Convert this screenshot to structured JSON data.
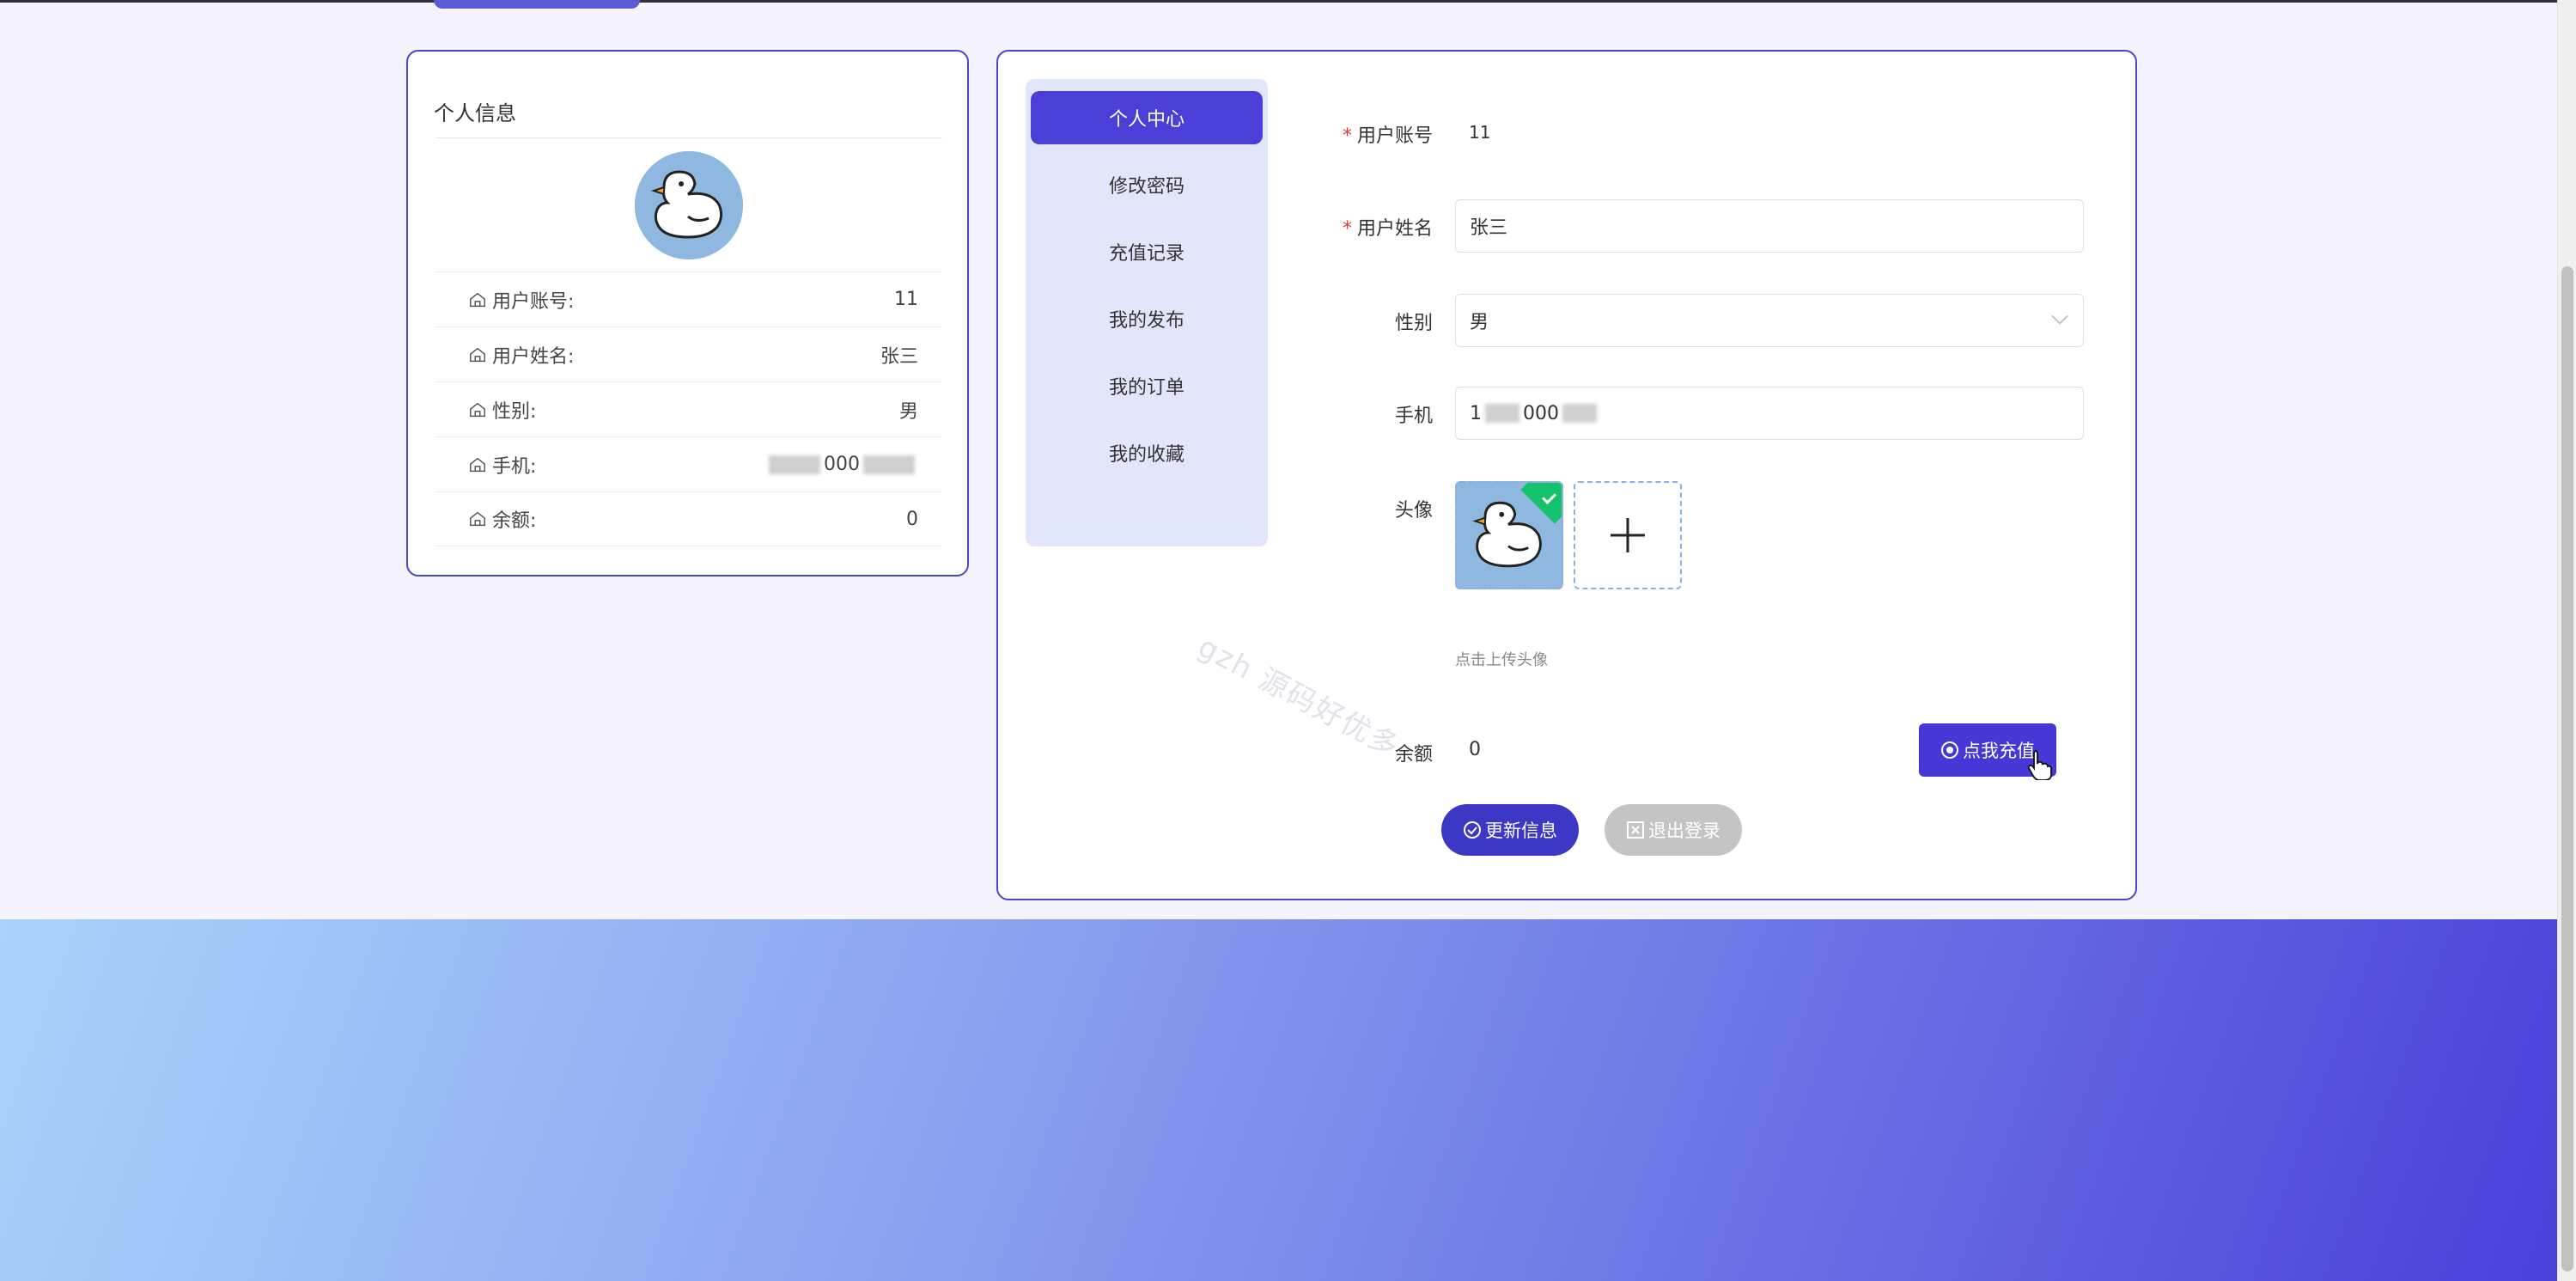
{
  "left_card": {
    "title": "个人信息",
    "rows": [
      {
        "label": "用户账号:",
        "value": "11"
      },
      {
        "label": "用户姓名:",
        "value": "张三"
      },
      {
        "label": "性别:",
        "value": "男"
      },
      {
        "label": "手机:",
        "value_suffix": "000"
      },
      {
        "label": "余额:",
        "value": "0"
      }
    ]
  },
  "menu": {
    "items": [
      {
        "label": "个人中心",
        "active": true
      },
      {
        "label": "修改密码"
      },
      {
        "label": "充值记录"
      },
      {
        "label": "我的发布"
      },
      {
        "label": "我的订单"
      },
      {
        "label": "我的收藏"
      }
    ]
  },
  "form": {
    "required_mark": "*",
    "account_label": "用户账号",
    "account_value": "11",
    "name_label": "用户姓名",
    "name_value": "张三",
    "gender_label": "性别",
    "gender_value": "男",
    "phone_label": "手机",
    "phone_prefix": "1",
    "phone_suffix": "000",
    "avatar_label": "头像",
    "upload_hint": "点击上传头像",
    "balance_label": "余额",
    "balance_value": "0",
    "recharge_label": "点我充值",
    "update_label": "更新信息",
    "logout_label": "退出登录"
  },
  "watermark": "gzh 源码好优多",
  "colors": {
    "accent": "#4538d6",
    "menu_bg": "#e2e6fb",
    "success": "#13c26b",
    "disabled": "#c4c4c4"
  },
  "icons": {
    "row": "home-icon",
    "upload_add": "plus-icon",
    "select": "chevron-down-icon",
    "recharge": "coin-icon",
    "update": "check-circle-icon",
    "logout": "close-square-icon"
  }
}
